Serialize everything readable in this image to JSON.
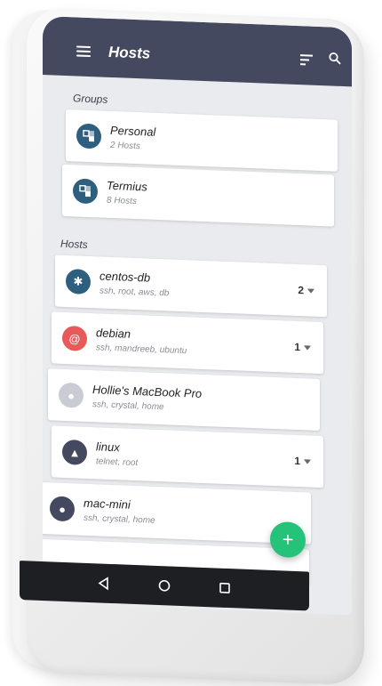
{
  "app_title": "Hosts",
  "groups_label": "Groups",
  "hosts_label": "Hosts",
  "groups": [
    {
      "title": "Personal",
      "subtitle": "2 Hosts"
    },
    {
      "title": "Termius",
      "subtitle": "8 Hosts"
    }
  ],
  "hosts": [
    {
      "title": "centos-db",
      "subtitle": "ssh, root, aws, db",
      "count": "2",
      "icon": "centos-icon",
      "color": "#2f5f7e"
    },
    {
      "title": "debian",
      "subtitle": "ssh, mandreeb, ubuntu",
      "count": "1",
      "icon": "debian-icon",
      "color": "#e85a5a"
    },
    {
      "title": "Hollie's MacBook Pro",
      "subtitle": "ssh, crystal, home",
      "count": "",
      "icon": "apple-icon",
      "color": "#c9ccd2"
    },
    {
      "title": "linux",
      "subtitle": "telnet, root",
      "count": "1",
      "icon": "linux-icon",
      "color": "#45495f"
    },
    {
      "title": "mac-mini",
      "subtitle": "ssh, crystal, home",
      "count": "",
      "icon": "apple-icon",
      "color": "#45495f"
    }
  ],
  "fab_label": "+",
  "colors": {
    "topbar": "#45495f",
    "fab": "#25c37a",
    "group_icon": "#2f5f7e"
  }
}
